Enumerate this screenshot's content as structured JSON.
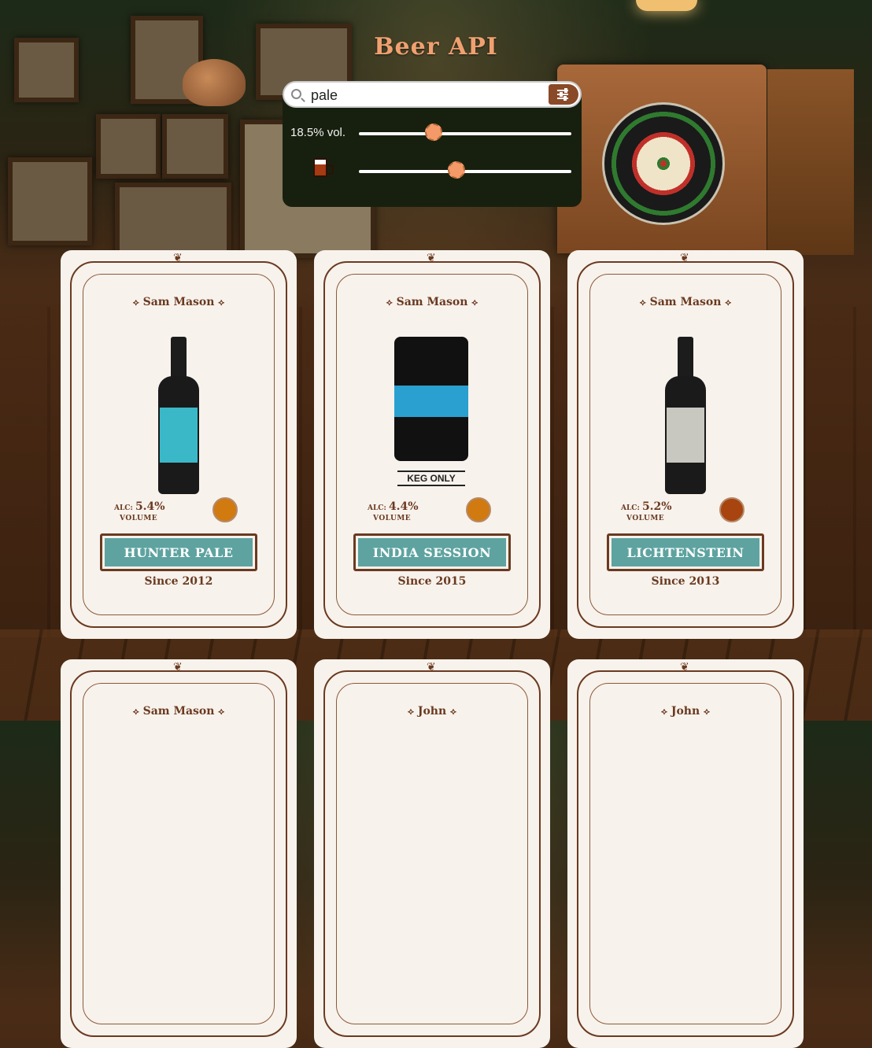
{
  "app": {
    "title": "Beer API"
  },
  "search": {
    "value": "pale",
    "placeholder": ""
  },
  "filters": {
    "abv_label": "18.5% vol.",
    "abv_level": 0.35,
    "color_level": 0.46
  },
  "colors": {
    "accent": "#f0a070",
    "ribbon": "#5ea3a0",
    "panel": "#17200f",
    "thumb": "#f49a68"
  },
  "cards": [
    {
      "brewer": "Sam Mason",
      "alc_prefix": "ALC:",
      "abv": "5.4%",
      "volume_label": "VOLUME",
      "name": "HUNTER PALE",
      "since": "Since 2012",
      "srm_color": "#d07a10",
      "image": "bottle"
    },
    {
      "brewer": "Sam Mason",
      "alc_prefix": "ALC:",
      "abv": "4.4%",
      "volume_label": "VOLUME",
      "name": "INDIA SESSION",
      "since": "Since 2015",
      "srm_color": "#d07a10",
      "image": "keg",
      "keg_label": "KEG ONLY"
    },
    {
      "brewer": "Sam Mason",
      "alc_prefix": "ALC:",
      "abv": "5.2%",
      "volume_label": "VOLUME",
      "name": "LICHTENSTEIN",
      "since": "Since 2013",
      "srm_color": "#a84410",
      "image": "bottle"
    },
    {
      "brewer": "Sam Mason"
    },
    {
      "brewer": "John"
    },
    {
      "brewer": "John"
    }
  ]
}
